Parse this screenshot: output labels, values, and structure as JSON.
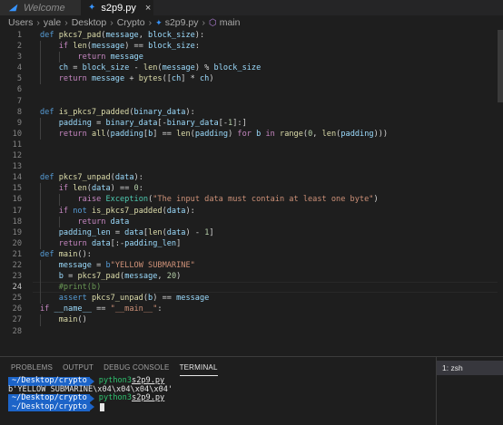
{
  "tabs": [
    {
      "label": "Welcome",
      "icon": "vscode-icon",
      "active": false
    },
    {
      "label": "s2p9.py",
      "icon": "python-file-icon",
      "active": true,
      "close": "×"
    }
  ],
  "breadcrumb": {
    "items": [
      "Users",
      "yale",
      "Desktop",
      "Crypto",
      "s2p9.py",
      "main"
    ],
    "separator": "›"
  },
  "editor": {
    "file": "s2p9.py",
    "current_line": 24,
    "lines": [
      {
        "n": "1",
        "indent": 0,
        "tokens": [
          [
            "kw",
            "def "
          ],
          [
            "fn",
            "pkcs7_pad"
          ],
          [
            "op",
            "("
          ],
          [
            "var",
            "message"
          ],
          [
            "op",
            ", "
          ],
          [
            "var",
            "block_size"
          ],
          [
            "op",
            "):"
          ]
        ]
      },
      {
        "n": "2",
        "indent": 1,
        "tokens": [
          [
            "ctl",
            "if "
          ],
          [
            "fn",
            "len"
          ],
          [
            "op",
            "("
          ],
          [
            "var",
            "message"
          ],
          [
            "op",
            ") == "
          ],
          [
            "var",
            "block_size"
          ],
          [
            "op",
            ":"
          ]
        ]
      },
      {
        "n": "3",
        "indent": 2,
        "tokens": [
          [
            "ctl",
            "return "
          ],
          [
            "var",
            "message"
          ]
        ]
      },
      {
        "n": "4",
        "indent": 1,
        "tokens": [
          [
            "var",
            "ch"
          ],
          [
            "op",
            " = "
          ],
          [
            "var",
            "block_size"
          ],
          [
            "op",
            " - "
          ],
          [
            "fn",
            "len"
          ],
          [
            "op",
            "("
          ],
          [
            "var",
            "message"
          ],
          [
            "op",
            ") % "
          ],
          [
            "var",
            "block_size"
          ]
        ]
      },
      {
        "n": "5",
        "indent": 1,
        "tokens": [
          [
            "ctl",
            "return "
          ],
          [
            "var",
            "message"
          ],
          [
            "op",
            " + "
          ],
          [
            "fn",
            "bytes"
          ],
          [
            "op",
            "(["
          ],
          [
            "var",
            "ch"
          ],
          [
            "op",
            "] * "
          ],
          [
            "var",
            "ch"
          ],
          [
            "op",
            ")"
          ]
        ]
      },
      {
        "n": "6",
        "indent": 0,
        "tokens": []
      },
      {
        "n": "7",
        "indent": 0,
        "tokens": []
      },
      {
        "n": "8",
        "indent": 0,
        "tokens": [
          [
            "kw",
            "def "
          ],
          [
            "fn",
            "is_pkcs7_padded"
          ],
          [
            "op",
            "("
          ],
          [
            "var",
            "binary_data"
          ],
          [
            "op",
            "):"
          ]
        ]
      },
      {
        "n": "9",
        "indent": 1,
        "tokens": [
          [
            "var",
            "padding"
          ],
          [
            "op",
            " = "
          ],
          [
            "var",
            "binary_data"
          ],
          [
            "op",
            "[-"
          ],
          [
            "var",
            "binary_data"
          ],
          [
            "op",
            "[-"
          ],
          [
            "num",
            "1"
          ],
          [
            "op",
            "]:]"
          ]
        ]
      },
      {
        "n": "10",
        "indent": 1,
        "tokens": [
          [
            "ctl",
            "return "
          ],
          [
            "fn",
            "all"
          ],
          [
            "op",
            "("
          ],
          [
            "var",
            "padding"
          ],
          [
            "op",
            "["
          ],
          [
            "var",
            "b"
          ],
          [
            "op",
            "] == "
          ],
          [
            "fn",
            "len"
          ],
          [
            "op",
            "("
          ],
          [
            "var",
            "padding"
          ],
          [
            "op",
            ") "
          ],
          [
            "ctl",
            "for "
          ],
          [
            "var",
            "b"
          ],
          [
            "ctl",
            " in "
          ],
          [
            "fn",
            "range"
          ],
          [
            "op",
            "("
          ],
          [
            "num",
            "0"
          ],
          [
            "op",
            ", "
          ],
          [
            "fn",
            "len"
          ],
          [
            "op",
            "("
          ],
          [
            "var",
            "padding"
          ],
          [
            "op",
            ")))"
          ]
        ]
      },
      {
        "n": "11",
        "indent": 0,
        "tokens": []
      },
      {
        "n": "12",
        "indent": 0,
        "tokens": []
      },
      {
        "n": "13",
        "indent": 0,
        "tokens": []
      },
      {
        "n": "14",
        "indent": 0,
        "tokens": [
          [
            "kw",
            "def "
          ],
          [
            "fn",
            "pkcs7_unpad"
          ],
          [
            "op",
            "("
          ],
          [
            "var",
            "data"
          ],
          [
            "op",
            "):"
          ]
        ]
      },
      {
        "n": "15",
        "indent": 1,
        "tokens": [
          [
            "ctl",
            "if "
          ],
          [
            "fn",
            "len"
          ],
          [
            "op",
            "("
          ],
          [
            "var",
            "data"
          ],
          [
            "op",
            ") == "
          ],
          [
            "num",
            "0"
          ],
          [
            "op",
            ":"
          ]
        ]
      },
      {
        "n": "16",
        "indent": 2,
        "tokens": [
          [
            "ctl",
            "raise "
          ],
          [
            "cls",
            "Exception"
          ],
          [
            "op",
            "("
          ],
          [
            "str",
            "\"The input data must contain at least one byte\""
          ],
          [
            "op",
            ")"
          ]
        ]
      },
      {
        "n": "17",
        "indent": 1,
        "tokens": [
          [
            "ctl",
            "if "
          ],
          [
            "kw",
            "not "
          ],
          [
            "fn",
            "is_pkcs7_padded"
          ],
          [
            "op",
            "("
          ],
          [
            "var",
            "data"
          ],
          [
            "op",
            "):"
          ]
        ]
      },
      {
        "n": "18",
        "indent": 2,
        "tokens": [
          [
            "ctl",
            "return "
          ],
          [
            "var",
            "data"
          ]
        ]
      },
      {
        "n": "19",
        "indent": 1,
        "tokens": [
          [
            "var",
            "padding_len"
          ],
          [
            "op",
            " = "
          ],
          [
            "var",
            "data"
          ],
          [
            "op",
            "["
          ],
          [
            "fn",
            "len"
          ],
          [
            "op",
            "("
          ],
          [
            "var",
            "data"
          ],
          [
            "op",
            ") - "
          ],
          [
            "num",
            "1"
          ],
          [
            "op",
            "]"
          ]
        ]
      },
      {
        "n": "20",
        "indent": 1,
        "tokens": [
          [
            "ctl",
            "return "
          ],
          [
            "var",
            "data"
          ],
          [
            "op",
            "[:-"
          ],
          [
            "var",
            "padding_len"
          ],
          [
            "op",
            "]"
          ]
        ]
      },
      {
        "n": "21",
        "indent": 0,
        "tokens": [
          [
            "kw",
            "def "
          ],
          [
            "fn",
            "main"
          ],
          [
            "op",
            "():"
          ]
        ]
      },
      {
        "n": "22",
        "indent": 1,
        "tokens": [
          [
            "var",
            "message"
          ],
          [
            "op",
            " = "
          ],
          [
            "kw",
            "b"
          ],
          [
            "str",
            "\"YELLOW SUBMARINE\""
          ]
        ]
      },
      {
        "n": "23",
        "indent": 1,
        "tokens": [
          [
            "var",
            "b"
          ],
          [
            "op",
            " = "
          ],
          [
            "fn",
            "pkcs7_pad"
          ],
          [
            "op",
            "("
          ],
          [
            "var",
            "message"
          ],
          [
            "op",
            ", "
          ],
          [
            "num",
            "20"
          ],
          [
            "op",
            ")"
          ]
        ]
      },
      {
        "n": "24",
        "indent": 1,
        "tokens": [
          [
            "cmt",
            "#print(b)"
          ]
        ]
      },
      {
        "n": "25",
        "indent": 1,
        "tokens": [
          [
            "kw",
            "assert "
          ],
          [
            "fn",
            "pkcs7_unpad"
          ],
          [
            "op",
            "("
          ],
          [
            "var",
            "b"
          ],
          [
            "op",
            ") == "
          ],
          [
            "var",
            "message"
          ]
        ]
      },
      {
        "n": "26",
        "indent": 0,
        "tokens": [
          [
            "ctl",
            "if "
          ],
          [
            "var",
            "__name__"
          ],
          [
            "op",
            " == "
          ],
          [
            "str",
            "\"__main__\""
          ],
          [
            "op",
            ":"
          ]
        ]
      },
      {
        "n": "27",
        "indent": 1,
        "tokens": [
          [
            "fn",
            "main"
          ],
          [
            "op",
            "()"
          ]
        ]
      },
      {
        "n": "28",
        "indent": 0,
        "tokens": []
      }
    ]
  },
  "panel": {
    "tabs": [
      "PROBLEMS",
      "OUTPUT",
      "DEBUG CONSOLE",
      "TERMINAL"
    ],
    "active_tab": "TERMINAL",
    "terminals": [
      "1: zsh"
    ],
    "lines": [
      {
        "type": "prompt",
        "path": "~/Desktop/crypto",
        "cmd": "python3",
        "arg": "s2p9.py"
      },
      {
        "type": "output",
        "text": "b'YELLOW SUBMARINE\\x04\\x04\\x04\\x04'"
      },
      {
        "type": "prompt",
        "path": "~/Desktop/crypto",
        "cmd": "python3",
        "arg": "s2p9.py"
      },
      {
        "type": "prompt",
        "path": "~/Desktop/crypto",
        "cmd": "",
        "arg": "",
        "cursor": true
      }
    ]
  },
  "colors": {
    "editor_bg": "#1e1e1e",
    "prompt_bg": "#1c64c8",
    "command": "#2fc16e",
    "keyword": "#569cd6",
    "control": "#c586c0",
    "function": "#dcdcaa",
    "variable": "#9cdcfe",
    "string": "#ce9178",
    "number": "#b5cea8",
    "comment": "#6a9955"
  }
}
